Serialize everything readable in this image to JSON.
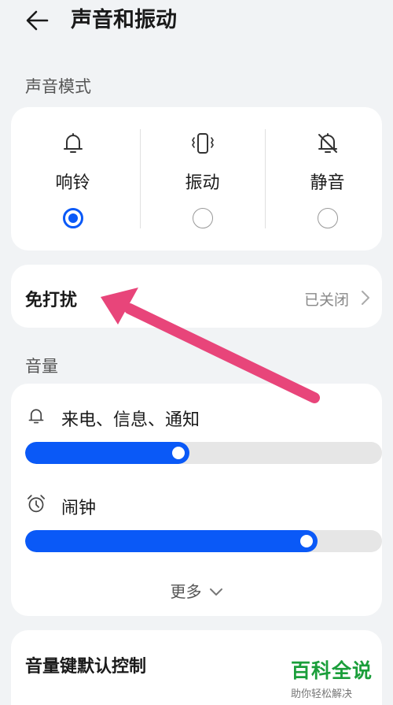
{
  "header": {
    "title": "声音和振动"
  },
  "sound_mode": {
    "section_label": "声音模式",
    "modes": [
      {
        "label": "响铃",
        "icon": "bell-icon",
        "selected": true
      },
      {
        "label": "振动",
        "icon": "vibrate-icon",
        "selected": false
      },
      {
        "label": "静音",
        "icon": "bell-off-icon",
        "selected": false
      }
    ]
  },
  "dnd": {
    "label": "免打扰",
    "value": "已关闭"
  },
  "volume": {
    "section_label": "音量",
    "items": [
      {
        "label": "来电、信息、通知",
        "icon": "bell-icon",
        "level": 0.46
      },
      {
        "label": "闹钟",
        "icon": "alarm-clock-icon",
        "level": 0.82
      }
    ],
    "more_label": "更多"
  },
  "volume_key": {
    "label": "音量键默认控制"
  },
  "watermark": {
    "main": "百科全说",
    "sub": "助你轻松解决"
  },
  "colors": {
    "accent": "#0a59f7",
    "arrow": "#e8457a",
    "watermark": "#1a9e3a"
  }
}
